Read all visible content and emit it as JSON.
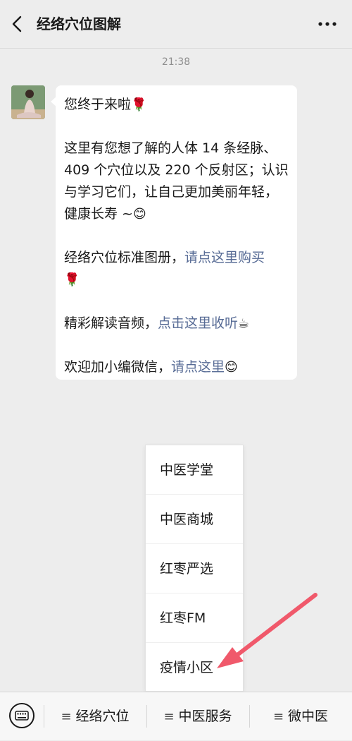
{
  "header": {
    "title": "经络穴位图解",
    "back_icon": "chevron-left-icon",
    "more_icon": "more-dots-icon"
  },
  "chat": {
    "timestamp": "21:38",
    "message": {
      "greeting": "您终于来啦",
      "greeting_emoji": "🌹",
      "intro": "这里有您想了解的人体 14 条经脉、409 个穴位以及 220 个反射区；认识与学习它们，让自己更加美丽年轻，健康长寿 ~",
      "intro_emoji": "😊",
      "atlas_prefix": "经络穴位标准图册，",
      "atlas_link": "请点这里购买",
      "atlas_emoji": "🌹",
      "audio_prefix": "精彩解读音频，",
      "audio_link": "点击这里收听",
      "audio_emoji": "☕",
      "wechat_prefix": "欢迎加小编微信，",
      "wechat_link": "请点这里",
      "wechat_emoji": "😊"
    }
  },
  "popup_menu": {
    "items": [
      {
        "label": "中医学堂"
      },
      {
        "label": "中医商城"
      },
      {
        "label": "红枣严选"
      },
      {
        "label": "红枣FM"
      },
      {
        "label": "疫情小区"
      }
    ]
  },
  "bottom_menu": {
    "keyboard_icon": "keyboard-icon",
    "tabs": [
      {
        "label": "经络穴位"
      },
      {
        "label": "中医服务"
      },
      {
        "label": "微中医"
      }
    ]
  },
  "colors": {
    "link": "#576b95",
    "background": "#ededed",
    "arrow": "#f0596b"
  }
}
